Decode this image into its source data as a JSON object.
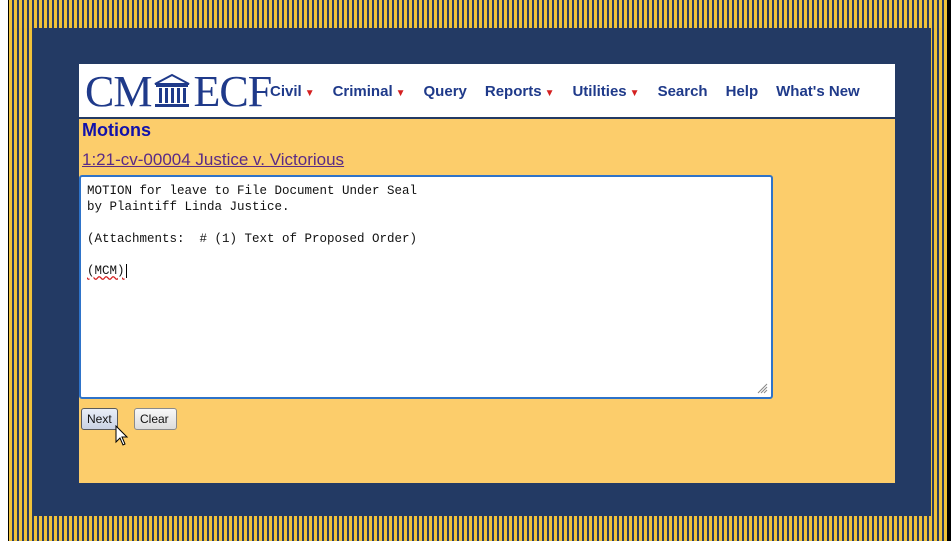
{
  "app": {
    "logo_left": "CM",
    "logo_right": "ECF",
    "logo_icon": "courthouse-icon"
  },
  "menu": {
    "items": [
      {
        "label": "Civil",
        "has_dropdown": true
      },
      {
        "label": "Criminal",
        "has_dropdown": true
      },
      {
        "label": "Query",
        "has_dropdown": false
      },
      {
        "label": "Reports",
        "has_dropdown": true
      },
      {
        "label": "Utilities",
        "has_dropdown": true
      },
      {
        "label": "Search",
        "has_dropdown": false
      },
      {
        "label": "Help",
        "has_dropdown": false
      },
      {
        "label": "What's New",
        "has_dropdown": false
      }
    ],
    "dropdown_caret_color": "#d42020"
  },
  "page": {
    "heading": "Motions",
    "case_link": "1:21-cv-00004 Justice v. Victorious"
  },
  "docket_text": {
    "lines": [
      "MOTION for leave to File Document Under Seal",
      "by Plaintiff Linda Justice.",
      "",
      "(Attachments:  # (1) Text of Proposed Order)",
      "",
      "(MCM)"
    ]
  },
  "buttons": {
    "next": "Next",
    "clear": "Clear"
  },
  "colors": {
    "navy": "#233a64",
    "gold": "#fccd6b",
    "link_blue": "#1f3a8a",
    "heading_blue": "#1212aa"
  }
}
